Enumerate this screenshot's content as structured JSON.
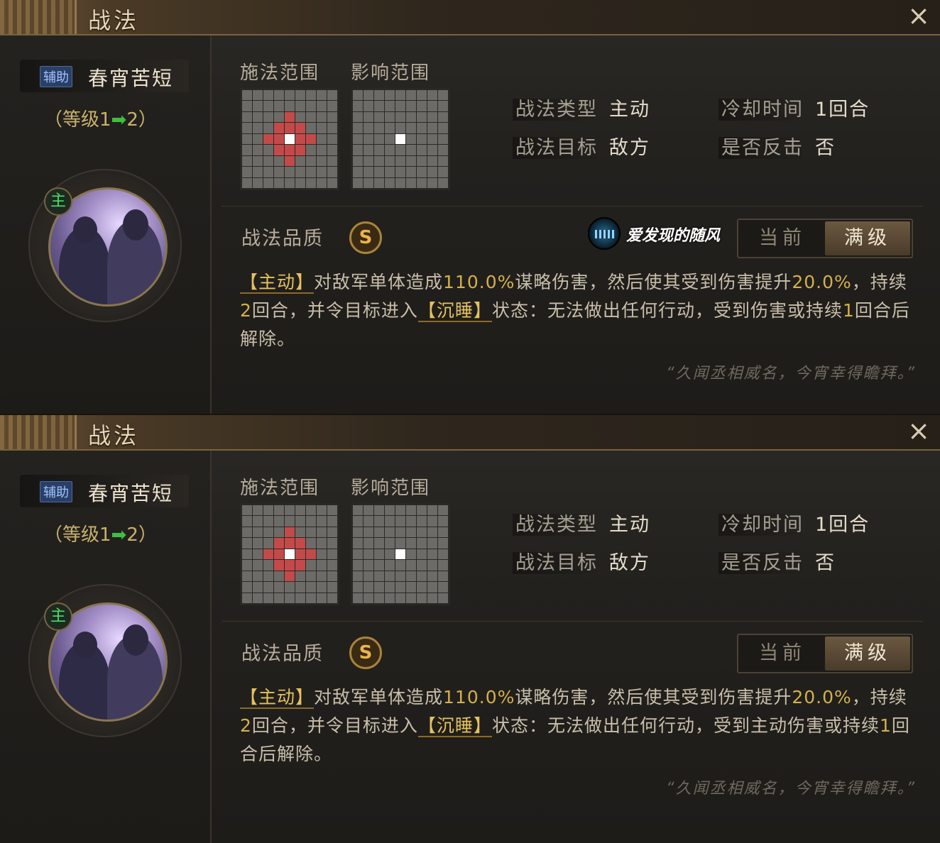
{
  "panels": [
    {
      "title": "战法",
      "close_icon": "×",
      "skill": {
        "tag": "辅助",
        "name": "春宵苦短"
      },
      "level": {
        "prefix": "（等级1",
        "arrow": "➡",
        "suffix": "2）"
      },
      "main_badge": "主",
      "cast_range_label": "施法范围",
      "effect_range_label": "影响范围",
      "info": {
        "type_label": "战法类型",
        "type_value": "主动",
        "cooldown_label": "冷却时间",
        "cooldown_value": "1回合",
        "target_label": "战法目标",
        "target_value": "敌方",
        "counter_label": "是否反击",
        "counter_value": "否"
      },
      "quality_label": "战法品质",
      "quality_value": "S",
      "watermark": "爱发现的随风",
      "toggle": {
        "current": "当前",
        "max": "满级",
        "selected": "max"
      },
      "desc": {
        "tag1": "【主动】",
        "t1": "对敌军单体造成",
        "n1": "110.0%",
        "t2": "谋略伤害，然后使其受到伤害提升",
        "n2": "20.0%",
        "t3": "，持续",
        "n3": "2",
        "t4": "回合，并令目标进入",
        "tag2": "【沉睡】",
        "t5": "状态：无法做出任何行动，受到伤害或持续",
        "n4": "1",
        "t6": "回合后解除。"
      },
      "quote": "“久闻丞相威名，今宵幸得瞻拜。”"
    },
    {
      "title": "战法",
      "close_icon": "×",
      "skill": {
        "tag": "辅助",
        "name": "春宵苦短"
      },
      "level": {
        "prefix": "（等级1",
        "arrow": "➡",
        "suffix": "2）"
      },
      "main_badge": "主",
      "cast_range_label": "施法范围",
      "effect_range_label": "影响范围",
      "info": {
        "type_label": "战法类型",
        "type_value": "主动",
        "cooldown_label": "冷却时间",
        "cooldown_value": "1回合",
        "target_label": "战法目标",
        "target_value": "敌方",
        "counter_label": "是否反击",
        "counter_value": "否"
      },
      "quality_label": "战法品质",
      "quality_value": "S",
      "toggle": {
        "current": "当前",
        "max": "满级",
        "selected": "max"
      },
      "desc": {
        "tag1": "【主动】",
        "t1": "对敌军单体造成",
        "n1": "110.0%",
        "t2": "谋略伤害，然后使其受到伤害提升",
        "n2": "20.0%",
        "t3": "，持续",
        "n3": "2",
        "t4": "回合，并令目标进入",
        "tag2": "【沉睡】",
        "t5": "状态：无法做出任何行动，受到主动伤害或持续",
        "n4": "1",
        "t6": "回合后解除。"
      },
      "quote": "“久闻丞相威名，今宵幸得瞻拜。”"
    }
  ],
  "colors": {
    "accent_gold": "#e3c25e",
    "range_red": "#c44a4a",
    "level_arrow": "#3fbf3f"
  }
}
